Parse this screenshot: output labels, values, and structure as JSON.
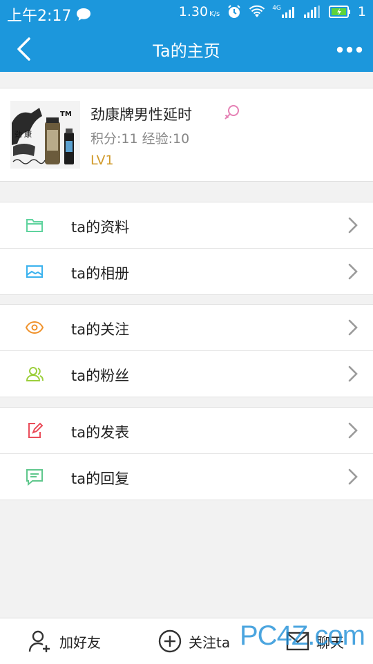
{
  "status_bar": {
    "time": "上午2:17",
    "speed": "1.30",
    "speed_unit": "K/s",
    "network": "4G",
    "sim_slot": "1"
  },
  "header": {
    "title": "Ta的主页"
  },
  "profile": {
    "name": "劲康牌男性延时",
    "stats": "积分:11 经验:10",
    "level": "LV1",
    "avatar_text_top": "劲",
    "avatar_text_2": "康",
    "avatar_tm": "TM"
  },
  "menu_groups": [
    [
      {
        "label": "ta的资料",
        "icon": "folder-icon",
        "color": "#5fd39e"
      },
      {
        "label": "ta的相册",
        "icon": "image-icon",
        "color": "#3ab2ee"
      }
    ],
    [
      {
        "label": "ta的关注",
        "icon": "eye-icon",
        "color": "#f0922b"
      },
      {
        "label": "ta的粉丝",
        "icon": "users-icon",
        "color": "#9ccf3c"
      }
    ],
    [
      {
        "label": "ta的发表",
        "icon": "edit-icon",
        "color": "#ea4d5a"
      },
      {
        "label": "ta的回复",
        "icon": "comment-icon",
        "color": "#5fc78c"
      }
    ]
  ],
  "bottom_bar": {
    "add_friend": "加好友",
    "follow": "关注ta",
    "chat": "聊天"
  },
  "watermark": "PC4Z.com",
  "colors": {
    "primary": "#1c97dc",
    "level": "#d19a2a",
    "gender": "#e57fb4"
  }
}
